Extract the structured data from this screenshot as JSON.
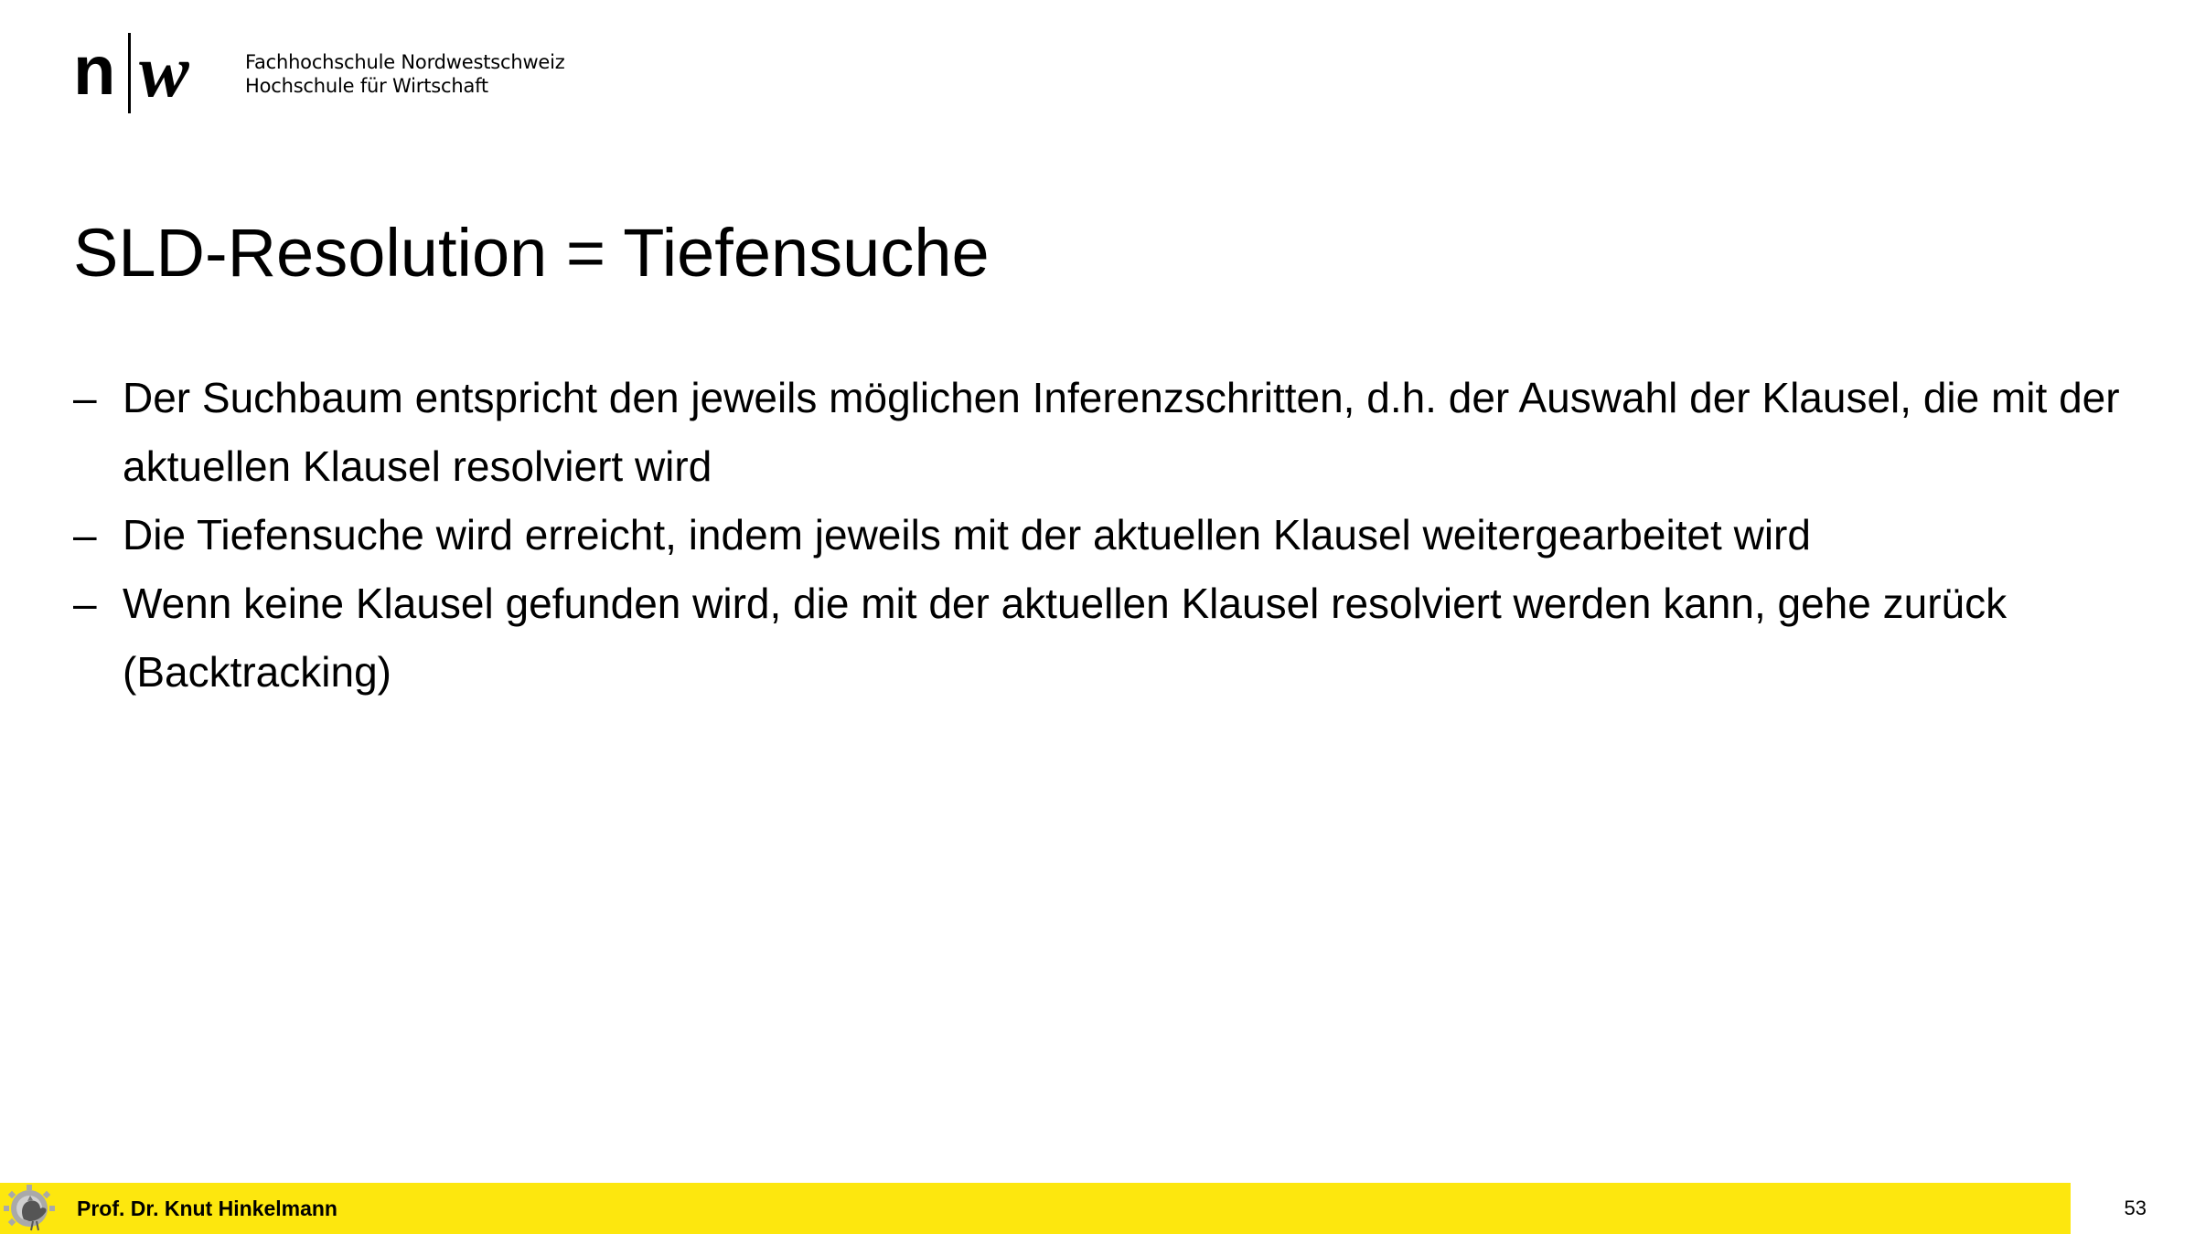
{
  "header": {
    "logo_n": "n",
    "logo_w": "w",
    "institution_line1": "Fachhochschule Nordwestschweiz",
    "institution_line2": "Hochschule für Wirtschaft"
  },
  "slide": {
    "title": "SLD-Resolution = Tiefensuche",
    "bullet_marker": "–",
    "bullets": [
      "Der Suchbaum entspricht den jeweils möglichen Inferenzschritten, d.h. der Auswahl der Klausel, die mit der aktuellen Klausel resolviert wird",
      "Die Tiefensuche wird erreicht, indem jeweils mit der aktuellen Klausel weitergearbeitet wird",
      "Wenn keine Klausel gefunden wird, die mit der aktuellen Klausel resolviert werden kann, gehe zurück (Backtracking)"
    ]
  },
  "footer": {
    "author": "Prof. Dr. Knut Hinkelmann",
    "page_number": "53",
    "emblem_icon": "rooster-gear-icon"
  },
  "colors": {
    "footer_bar": "#FDE70E",
    "text": "#000000",
    "background": "#FFFFFF"
  }
}
